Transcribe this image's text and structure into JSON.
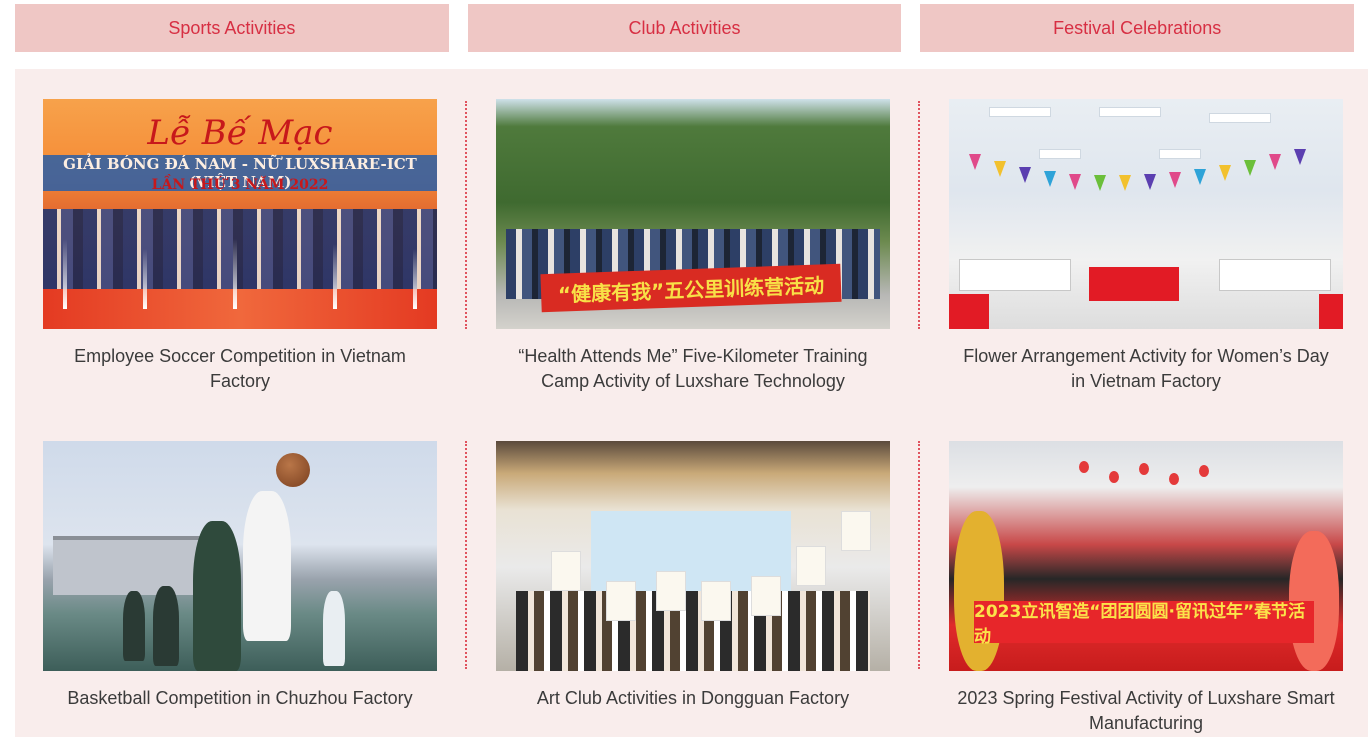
{
  "tabs": [
    "Sports Activities",
    "Club Activities",
    "Festival Celebrations"
  ],
  "photos": {
    "soccer": {
      "title": "Lễ Bế Mạc",
      "subtitle": "GIẢI BÓNG ĐÁ NAM - NỮ LUXSHARE-ICT (VIỆT NAM)",
      "edition": "LẦN THỨ 3 NĂM 2022"
    },
    "health": {
      "banner": "“健康有我”五公里训练营活动"
    },
    "festival": {
      "banner": "2023立讯智造“团团圆圆·留讯过年”春节活动"
    }
  },
  "captions": {
    "soccer": "Employee Soccer Competition in Vietnam Factory",
    "health": "“Health Attends Me” Five-Kilometer Training Camp Activity of Luxshare Technology",
    "flower": "Flower Arrangement Activity for Women’s Day in Vietnam Factory",
    "basketball": "Basketball Competition in Chuzhou Factory",
    "art": "Art Club Activities in Dongguan Factory",
    "spring": "2023 Spring Festival Activity of Luxshare Smart Manufacturing"
  },
  "colors": {
    "tab_bg": "#efc7c5",
    "tab_text": "#d72f43",
    "panel_bg": "#f9edec",
    "divider": "#e0545f"
  }
}
